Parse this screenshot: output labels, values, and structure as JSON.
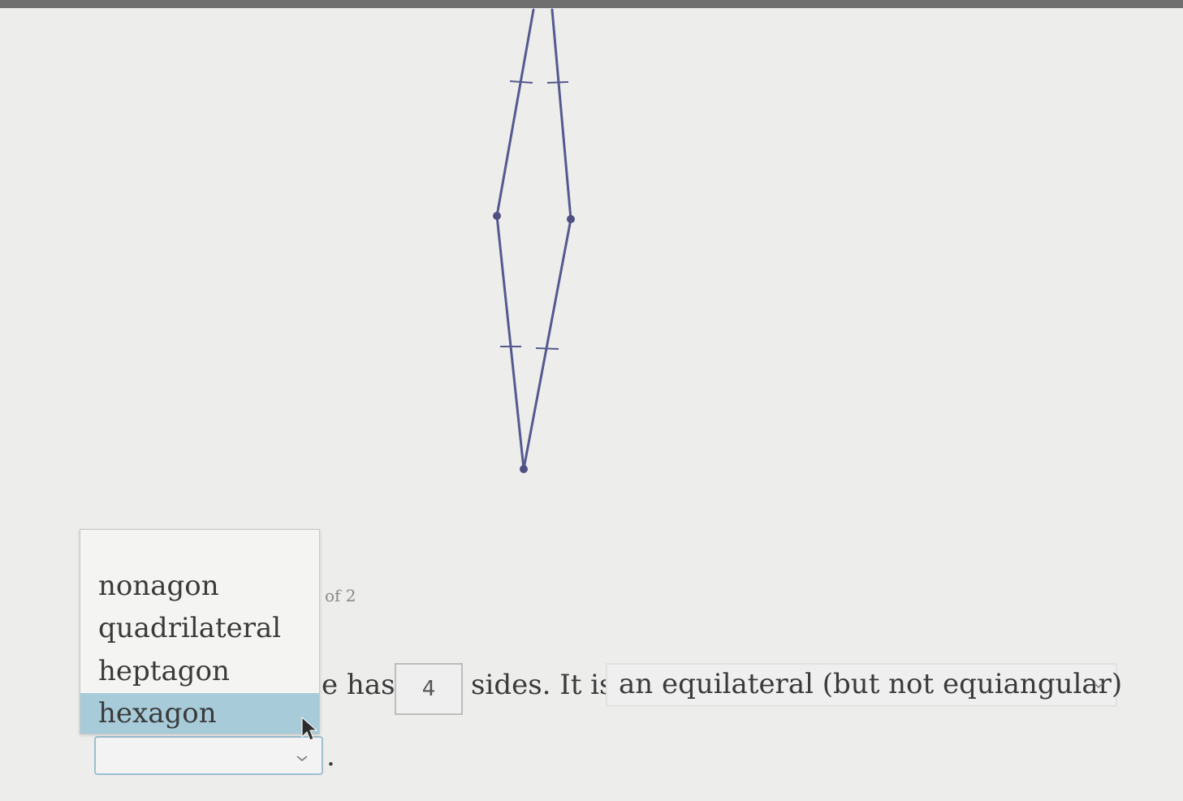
{
  "question": {
    "page_indicator": "of 2",
    "sentence_fragment_before": "e has",
    "sides_value": "4",
    "sentence_fragment_after": "sides. It is",
    "polygon_type_selected": "an equilateral (but not equiangular)",
    "sentence_end": "."
  },
  "shape_dropdown": {
    "options": [
      "nonagon",
      "quadrilateral",
      "heptagon",
      "hexagon"
    ],
    "highlighted": "hexagon",
    "selected_value": ""
  },
  "colors": {
    "polygon_stroke": "#55598f",
    "highlight": "#a7cbd9",
    "background": "#ededec"
  },
  "icons": {
    "dropdown": "chevron-down-icon",
    "pointer": "mouse-cursor-icon"
  }
}
